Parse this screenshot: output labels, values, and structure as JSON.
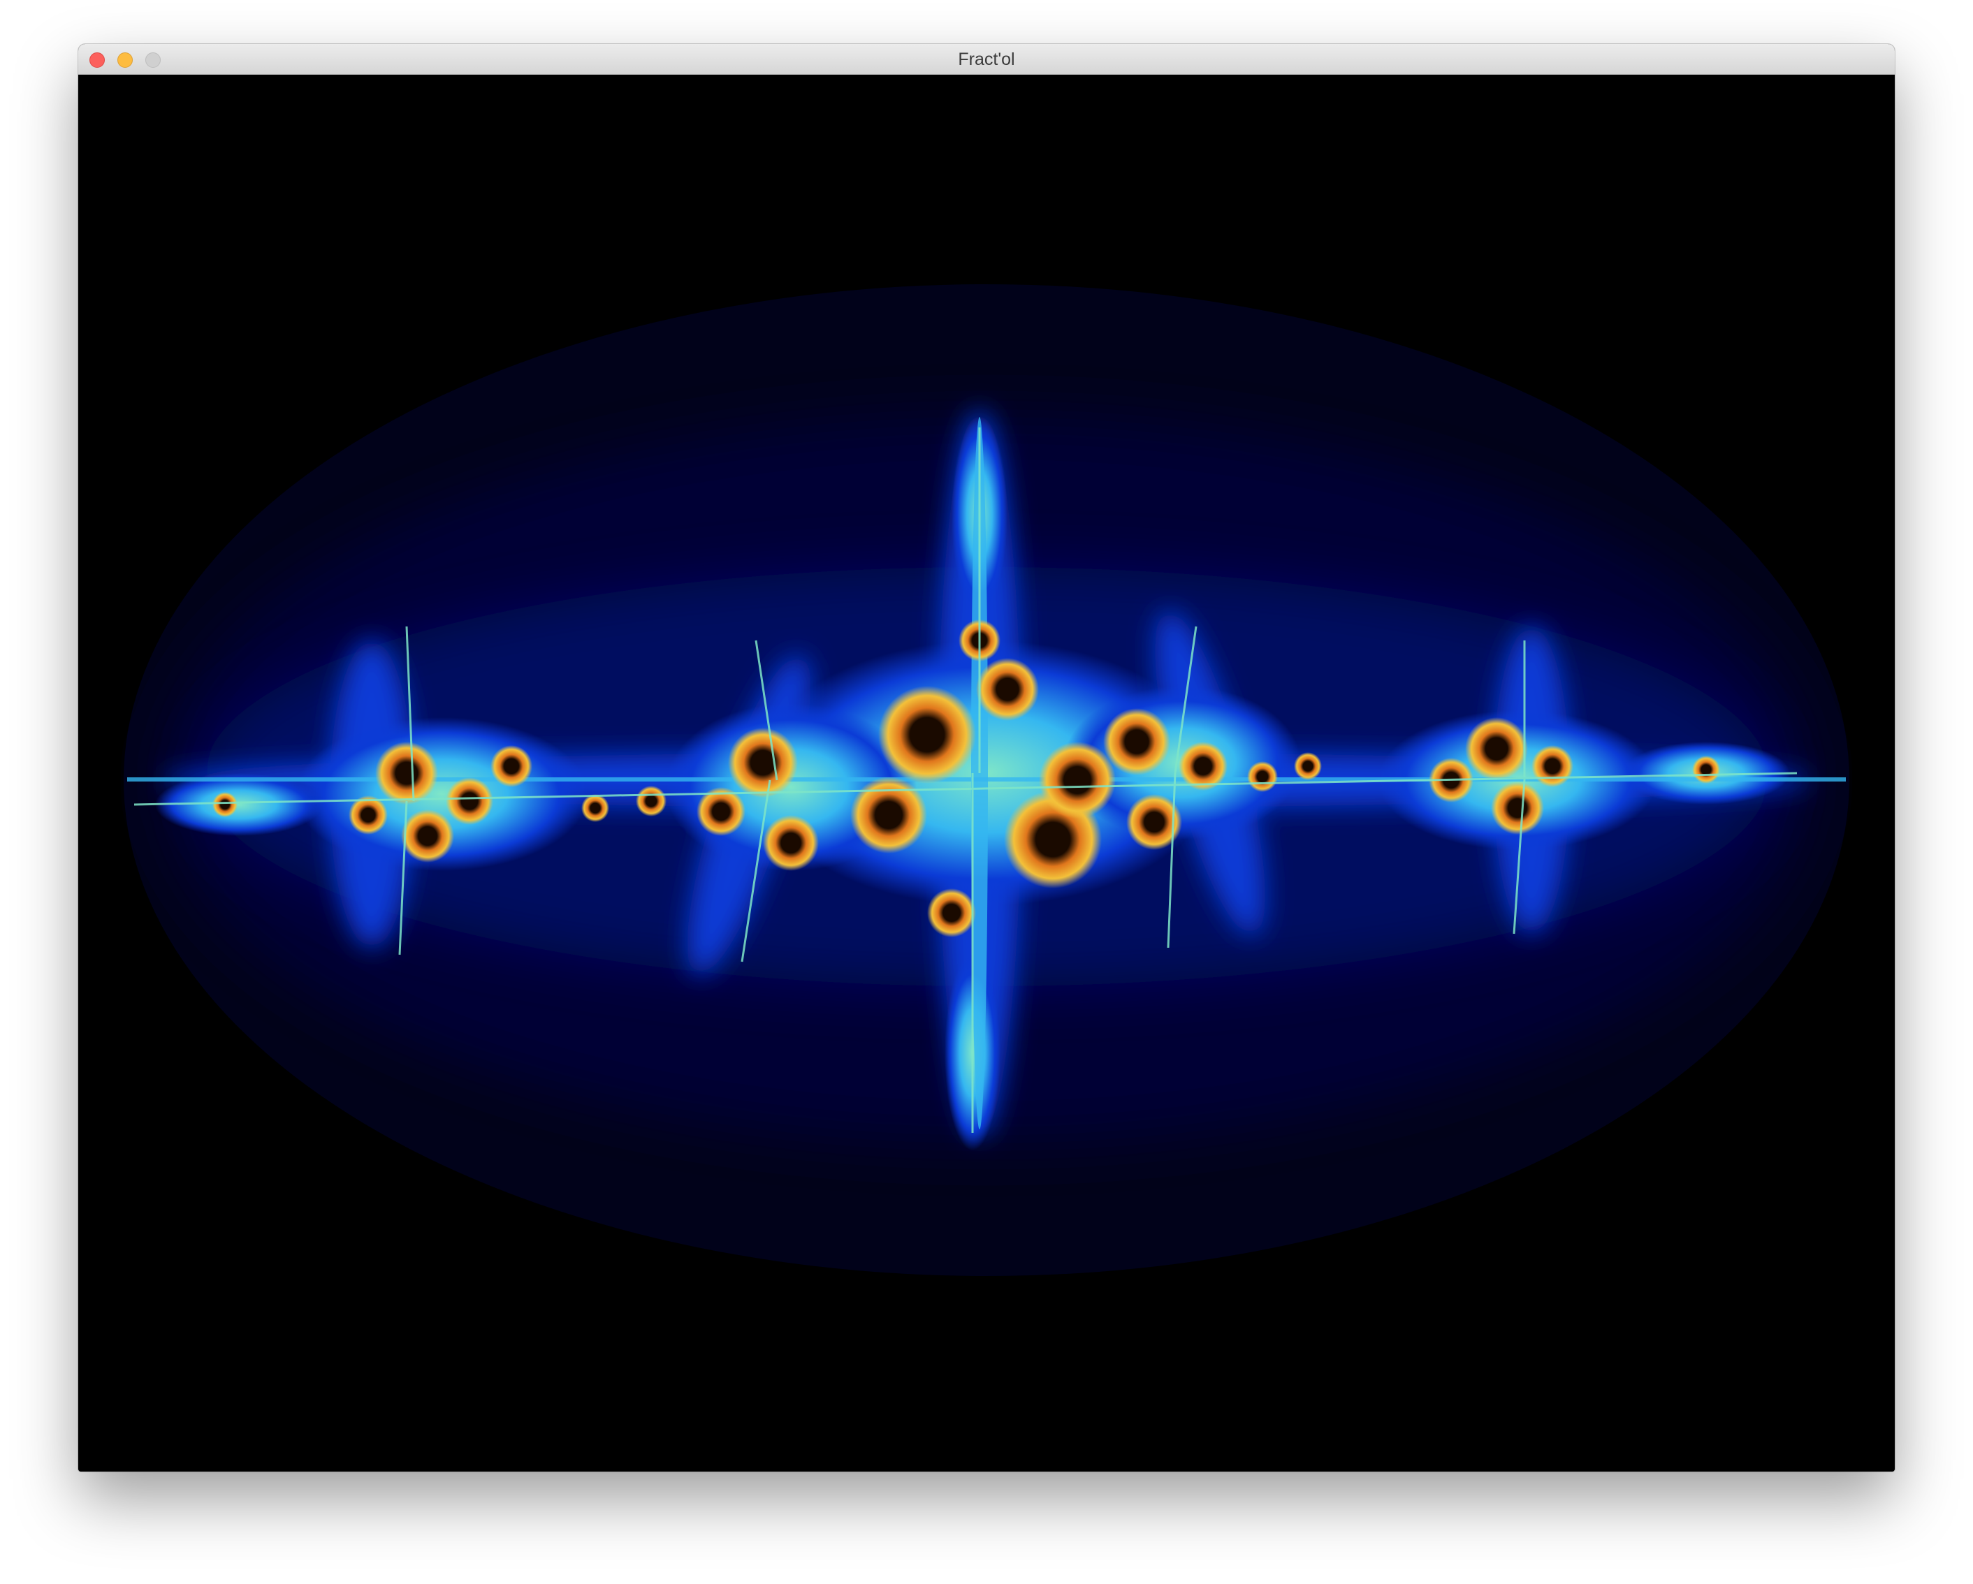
{
  "window": {
    "title": "Fract'ol",
    "buttons": [
      "close",
      "minimize",
      "zoom"
    ]
  },
  "canvas": {
    "content": "julia-set-fractal",
    "palette": {
      "background": "#000000",
      "outer_halo": "#01021a",
      "halo_mid": "#020636",
      "halo_inner": "#031061",
      "blue": "#0b3bd6",
      "cyan": "#35b7f0",
      "aqua": "#7fe6c8",
      "yellow": "#f3c13a",
      "orange": "#e0761c",
      "core": "#1a0a00"
    }
  }
}
